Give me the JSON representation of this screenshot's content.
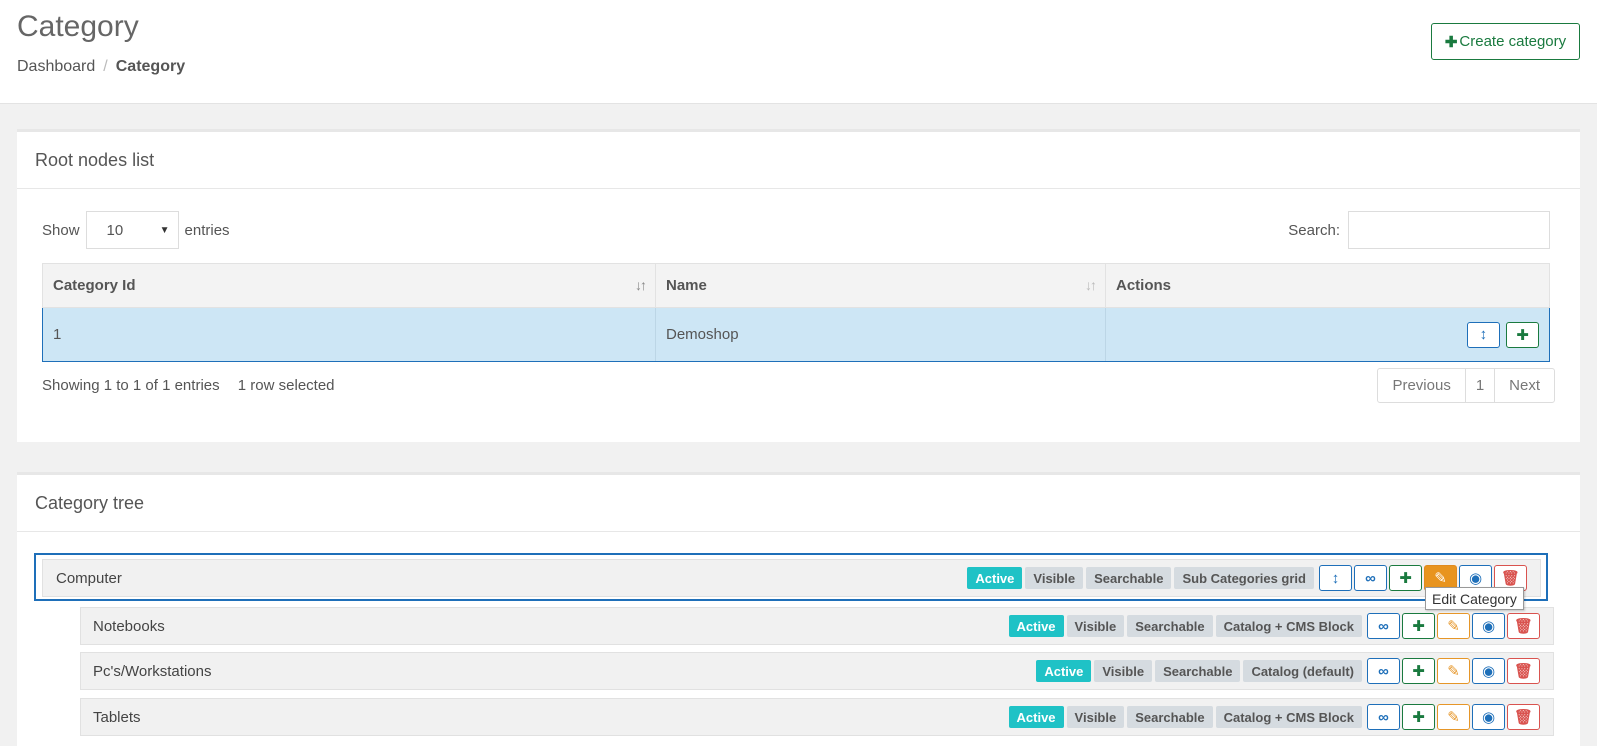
{
  "header": {
    "title": "Category",
    "breadcrumb": [
      "Dashboard",
      "Category"
    ],
    "create_button": "Create category"
  },
  "root_nodes": {
    "panel_title": "Root nodes list",
    "show_label": "Show",
    "page_length": "10",
    "entries_label": "entries",
    "search_label": "Search:",
    "search_value": "",
    "columns": [
      "Category Id",
      "Name",
      "Actions"
    ],
    "rows": [
      {
        "id": "1",
        "name": "Demoshop"
      }
    ],
    "info": "Showing 1 to 1 of 1 entries",
    "selected_info": "1 row selected",
    "pager": {
      "previous": "Previous",
      "page": "1",
      "next": "Next"
    }
  },
  "category_tree": {
    "panel_title": "Category tree",
    "nodes": [
      {
        "name": "Computer",
        "badges": [
          "Active",
          "Visible",
          "Searchable",
          "Sub Categories grid"
        ],
        "has_move": true,
        "selected": true
      },
      {
        "name": "Notebooks",
        "badges": [
          "Active",
          "Visible",
          "Searchable",
          "Catalog + CMS Block"
        ],
        "has_move": false
      },
      {
        "name": "Pc's/Workstations",
        "badges": [
          "Active",
          "Visible",
          "Searchable",
          "Catalog (default)"
        ],
        "has_move": false
      },
      {
        "name": "Tablets",
        "badges": [
          "Active",
          "Visible",
          "Searchable",
          "Catalog + CMS Block"
        ],
        "has_move": false
      }
    ],
    "tooltip": "Edit Category"
  },
  "colors": {
    "accent_green": "#1a7a3f",
    "accent_blue": "#1e6fb9",
    "active_badge": "#1fc2c6",
    "edit_orange": "#e8941f",
    "delete_red": "#d9534f",
    "row_selected": "#cde6f5"
  }
}
